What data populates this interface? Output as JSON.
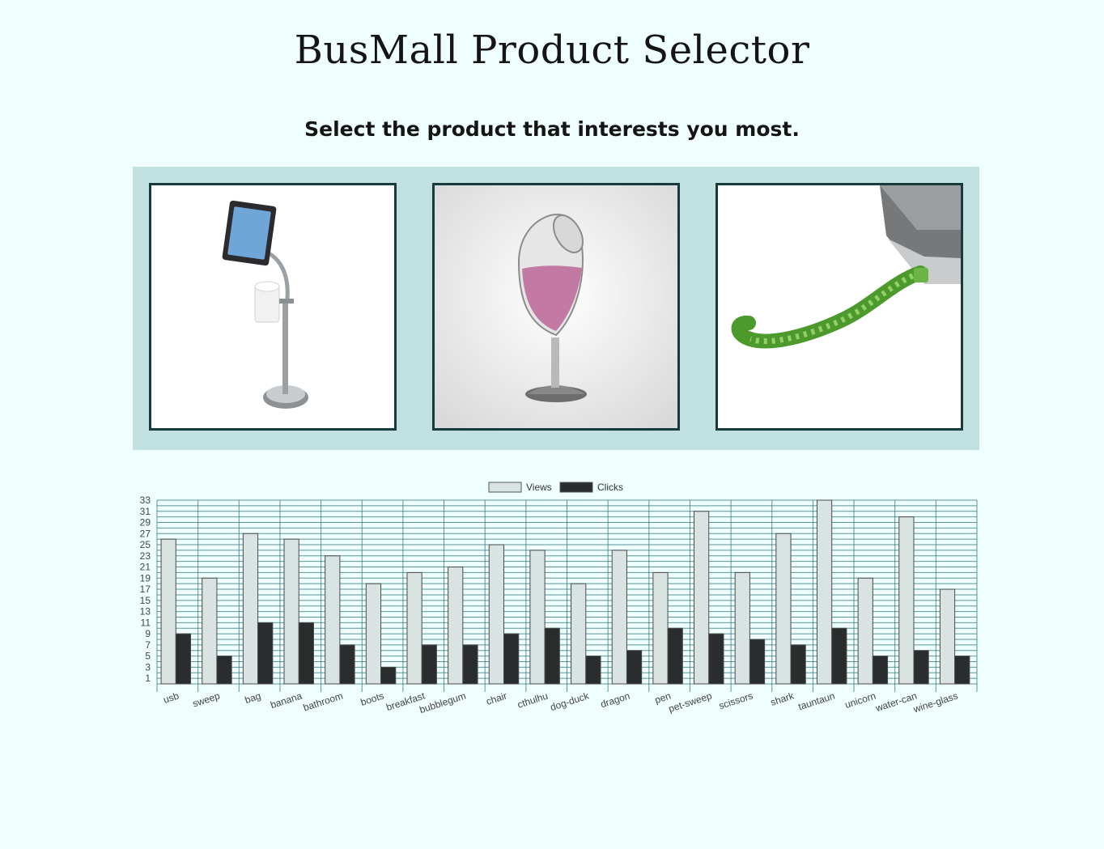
{
  "header": {
    "title": "BusMall Product Selector",
    "instructions": "Select the product that interests you most."
  },
  "products": [
    {
      "name": "tablet toilet paper stand",
      "icon": "bathroom-stand-image"
    },
    {
      "name": "wine glass",
      "icon": "wine-glass-image"
    },
    {
      "name": "tentacle usb",
      "icon": "usb-tentacle-image"
    }
  ],
  "colors": {
    "background": "#eefffe",
    "panel": "#c1e1e0",
    "card_border": "#173b3d",
    "views_fill": "#d9e3e2",
    "clicks_fill": "#2a2d2e",
    "grid": "#2f7377"
  },
  "chart_data": {
    "type": "bar",
    "legend": [
      "Views",
      "Clicks"
    ],
    "legend_position": "top-center",
    "categories": [
      "usb",
      "sweep",
      "bag",
      "banana",
      "bathroom",
      "boots",
      "breakfast",
      "bubblegum",
      "chair",
      "cthulhu",
      "dog-duck",
      "dragon",
      "pen",
      "pet-sweep",
      "scissors",
      "shark",
      "tauntaun",
      "unicorn",
      "water-can",
      "wine-glass"
    ],
    "series": [
      {
        "name": "Views",
        "values": [
          26,
          19,
          27,
          26,
          23,
          18,
          20,
          21,
          25,
          24,
          18,
          24,
          20,
          31,
          20,
          27,
          33,
          19,
          30,
          17
        ]
      },
      {
        "name": "Clicks",
        "values": [
          9,
          5,
          11,
          11,
          7,
          3,
          7,
          7,
          9,
          10,
          5,
          6,
          10,
          9,
          8,
          7,
          10,
          5,
          6,
          5
        ]
      }
    ],
    "y_ticks": [
      1,
      3,
      5,
      7,
      9,
      11,
      13,
      15,
      17,
      19,
      21,
      23,
      25,
      27,
      29,
      31,
      33
    ],
    "ylim": [
      0,
      33
    ],
    "grid": true
  }
}
